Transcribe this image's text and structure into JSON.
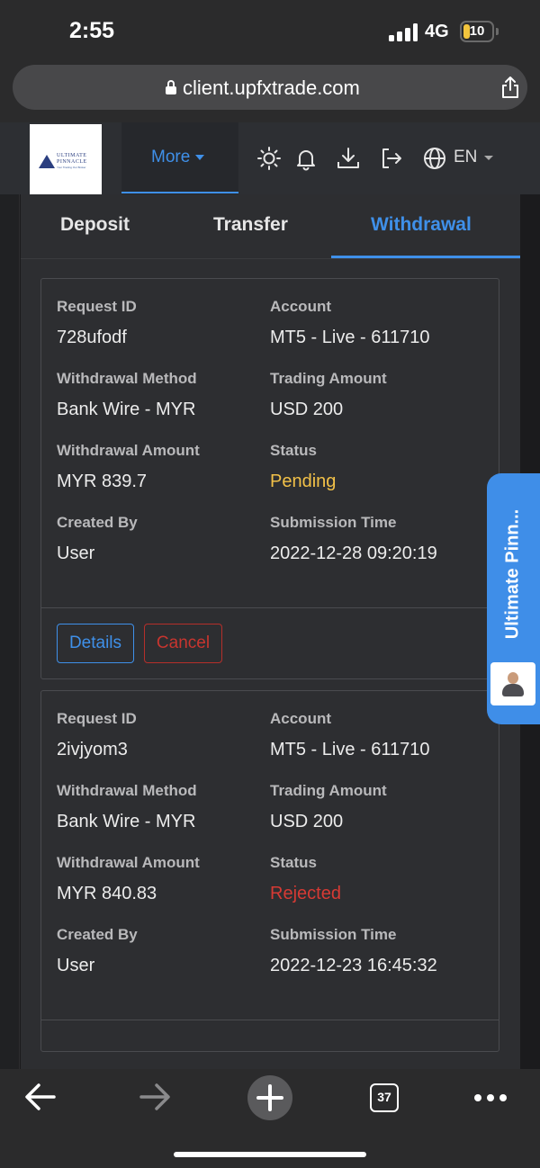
{
  "status_bar": {
    "time": "2:55",
    "network": "4G",
    "battery_level": "10",
    "battery_color": "#f3c53d"
  },
  "browser": {
    "url": "client.upfxtrade.com",
    "icons": [
      "lock-icon",
      "share-icon"
    ]
  },
  "header": {
    "logo": {
      "name_line1": "ULTIMATE",
      "name_line2": "PINNACLE",
      "tagline": "Your Trading Our Broker"
    },
    "more_label": "More",
    "language": "EN",
    "icons": [
      "theme-sun-icon",
      "notification-bell-icon",
      "download-icon",
      "logout-icon",
      "globe-icon"
    ],
    "accent_color": "#3f90e9"
  },
  "tabs": [
    {
      "label": "Deposit",
      "active": false
    },
    {
      "label": "Transfer",
      "active": false
    },
    {
      "label": "Withdrawal",
      "active": true
    }
  ],
  "labels": {
    "request_id": "Request ID",
    "account": "Account",
    "withdrawal_method": "Withdrawal Method",
    "trading_amount": "Trading Amount",
    "withdrawal_amount": "Withdrawal Amount",
    "status": "Status",
    "created_by": "Created By",
    "submission_time": "Submission Time"
  },
  "requests": [
    {
      "request_id": "728ufodf",
      "account": "MT5 - Live - 611710",
      "withdrawal_method": "Bank Wire - MYR",
      "trading_amount": "USD 200",
      "withdrawal_amount": "MYR 839.7",
      "status": "Pending",
      "status_color": "#f2c148",
      "created_by": "User",
      "submission_time": "2022-12-28 09:20:19",
      "actions": {
        "details": "Details",
        "cancel": "Cancel"
      }
    },
    {
      "request_id": "2ivjyom3",
      "account": "MT5 - Live - 611710",
      "withdrawal_method": "Bank Wire - MYR",
      "trading_amount": "USD 200",
      "withdrawal_amount": "MYR 840.83",
      "status": "Rejected",
      "status_color": "#d63a34",
      "created_by": "User",
      "submission_time": "2022-12-23 16:45:32"
    }
  ],
  "widget": {
    "label": "Ultimate Pinn...",
    "color": "#3f8ee8"
  },
  "toolbar": {
    "tabs_count": "37",
    "icons": [
      "back-arrow-icon",
      "forward-arrow-icon",
      "new-tab-plus-icon",
      "tabs-icon",
      "more-dots-icon"
    ]
  }
}
